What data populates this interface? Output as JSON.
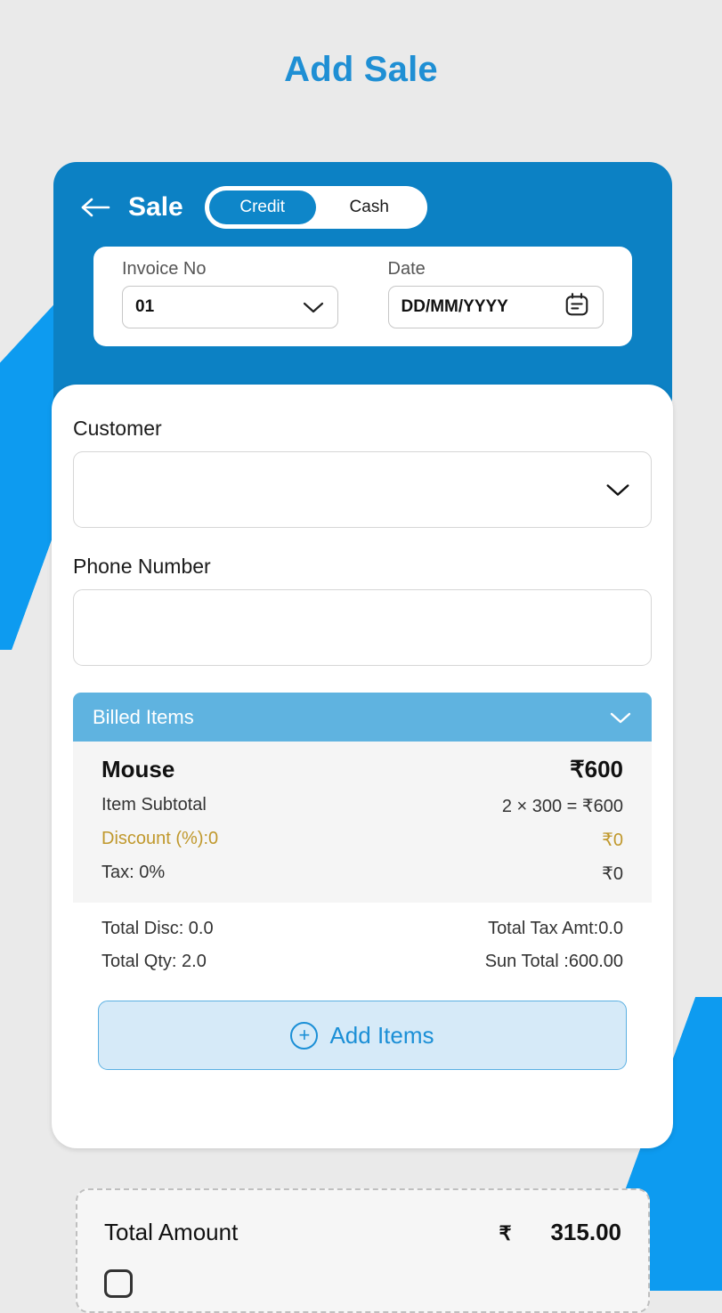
{
  "page": {
    "title": "Add Sale"
  },
  "header": {
    "back_icon": "arrow-left-icon",
    "title": "Sale",
    "toggle": {
      "options": [
        "Credit",
        "Cash"
      ],
      "selected": "Credit"
    }
  },
  "invoice": {
    "invoice_label": "Invoice No",
    "invoice_value": "01",
    "invoice_chevron": "chevron-down-icon",
    "date_label": "Date",
    "date_value": "DD/MM/YYYY",
    "date_icon": "calendar-icon"
  },
  "form": {
    "customer_label": "Customer",
    "customer_value": "",
    "customer_chevron": "chevron-down-icon",
    "phone_label": "Phone Number",
    "phone_value": ""
  },
  "billed_items": {
    "section_title": "Billed Items",
    "collapse_icon": "chevron-down-icon",
    "items": [
      {
        "name": "Mouse",
        "price": "₹600",
        "subtotal_label": "Item Subtotal",
        "subtotal_value": "2 × 300 = ₹600",
        "discount_label": "Discount (%):0",
        "discount_value": "₹0",
        "tax_label": "Tax: 0%",
        "tax_value": "₹0"
      }
    ],
    "totals": {
      "total_disc": "Total Disc: 0.0",
      "total_tax": "Total Tax Amt:0.0",
      "total_qty": "Total Qty: 2.0",
      "sun_total": "Sun Total :600.00"
    },
    "add_items_label": "Add Items",
    "add_items_icon": "plus-circle-icon"
  },
  "total_amount": {
    "label": "Total Amount",
    "currency": "₹",
    "value": "315.00"
  },
  "colors": {
    "accent_blue": "#0c81c4",
    "bright_blue": "#0d9bf0",
    "title_blue": "#1f8fd4",
    "section_blue": "#5fb3e0",
    "button_fill": "#d6eaf8",
    "discount_gold": "#c0982c",
    "page_bg": "#eaeaea"
  }
}
